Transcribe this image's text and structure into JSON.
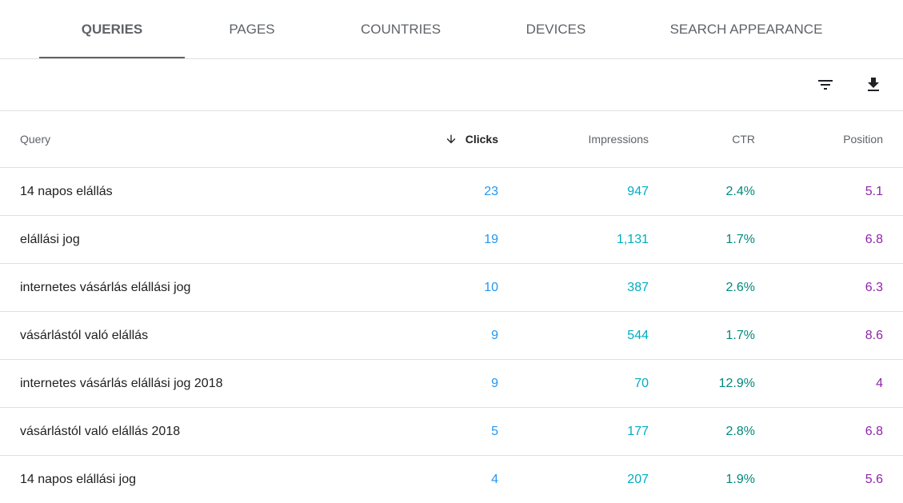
{
  "tabs": [
    {
      "label": "QUERIES",
      "active": true
    },
    {
      "label": "PAGES",
      "active": false
    },
    {
      "label": "COUNTRIES",
      "active": false
    },
    {
      "label": "DEVICES",
      "active": false
    },
    {
      "label": "SEARCH APPEARANCE",
      "active": false
    }
  ],
  "toolbar": {
    "filter_icon": "filter-list-icon",
    "download_icon": "download-icon"
  },
  "table": {
    "headers": {
      "query": "Query",
      "clicks": "Clicks",
      "impressions": "Impressions",
      "ctr": "CTR",
      "position": "Position"
    },
    "sort": {
      "column": "clicks",
      "direction": "descending"
    },
    "rows": [
      {
        "query": "14 napos elállás",
        "clicks": "23",
        "impressions": "947",
        "ctr": "2.4%",
        "position": "5.1"
      },
      {
        "query": "elállási jog",
        "clicks": "19",
        "impressions": "1,131",
        "ctr": "1.7%",
        "position": "6.8"
      },
      {
        "query": "internetes vásárlás elállási jog",
        "clicks": "10",
        "impressions": "387",
        "ctr": "2.6%",
        "position": "6.3"
      },
      {
        "query": "vásárlástól való elállás",
        "clicks": "9",
        "impressions": "544",
        "ctr": "1.7%",
        "position": "8.6"
      },
      {
        "query": "internetes vásárlás elállási jog 2018",
        "clicks": "9",
        "impressions": "70",
        "ctr": "12.9%",
        "position": "4"
      },
      {
        "query": "vásárlástól való elállás 2018",
        "clicks": "5",
        "impressions": "177",
        "ctr": "2.8%",
        "position": "6.8"
      },
      {
        "query": "14 napos elállási jog",
        "clicks": "4",
        "impressions": "207",
        "ctr": "1.9%",
        "position": "5.6"
      }
    ]
  },
  "colors": {
    "clicks": "#2196f3",
    "impressions": "#00acc1",
    "ctr": "#00897b",
    "position": "#8e24aa"
  }
}
